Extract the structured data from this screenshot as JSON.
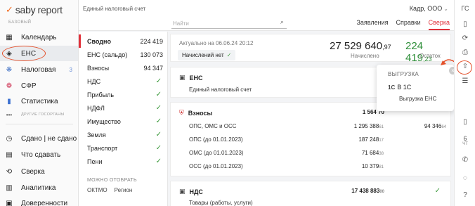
{
  "brand": {
    "check": "✓",
    "saby": "saby",
    "report": "report"
  },
  "sidebar": {
    "section_base": "БАЗОВЫЙ",
    "items": [
      {
        "label": "Календарь",
        "icon": "calendar-icon",
        "glyph": "▦",
        "count": ""
      },
      {
        "label": "ЕНС",
        "icon": "wallet-icon",
        "glyph": "◈",
        "count": ""
      },
      {
        "label": "Налоговая",
        "icon": "gear-icon",
        "glyph": "❋",
        "count": "3"
      },
      {
        "label": "СФР",
        "icon": "sfr-icon",
        "glyph": "❁",
        "count": ""
      },
      {
        "label": "Статистика",
        "icon": "chart-icon",
        "glyph": "▮",
        "count": ""
      }
    ],
    "more_glyph": "•••",
    "section_other": "ДРУГИЕ ГОСОРГАНЫ",
    "items2": [
      {
        "label": "Сдано | не сдано",
        "icon": "clock-icon",
        "glyph": "◷"
      },
      {
        "label": "Что сдавать",
        "icon": "docs-icon",
        "glyph": "▤"
      },
      {
        "label": "Сверка",
        "icon": "reconcile-icon",
        "glyph": "⟲"
      },
      {
        "label": "Аналитика",
        "icon": "analytics-icon",
        "glyph": "▥"
      },
      {
        "label": "Доверенности",
        "icon": "proxy-icon",
        "glyph": "▣"
      }
    ]
  },
  "topbar": {
    "breadcrumb": "Единый налоговый счет",
    "org": "Кадр, ООО",
    "org_chevron": "⌄",
    "search_placeholder": "Найти",
    "search_glyph": "⌕",
    "tabs": [
      {
        "label": "Заявления"
      },
      {
        "label": "Справки"
      },
      {
        "label": "Сверка"
      }
    ]
  },
  "list": {
    "items": [
      {
        "label": "Сводно",
        "value": "224 419",
        "ok": false
      },
      {
        "label": "ЕНС (сальдо)",
        "value": "130 073",
        "ok": false
      },
      {
        "label": "Взносы",
        "value": "94 347",
        "ok": false
      },
      {
        "label": "НДС",
        "value": "",
        "ok": true
      },
      {
        "label": "Прибыль",
        "value": "",
        "ok": true
      },
      {
        "label": "НДФЛ",
        "value": "",
        "ok": true
      },
      {
        "label": "Имущество",
        "value": "",
        "ok": true
      },
      {
        "label": "Земля",
        "value": "",
        "ok": true
      },
      {
        "label": "Транспорт",
        "value": "",
        "ok": true
      },
      {
        "label": "Пени",
        "value": "",
        "ok": true
      }
    ],
    "check": "✓",
    "filter_label": "МОЖНО ОТОБРАТЬ",
    "filter_opts": [
      "ОКТМО",
      "Регион"
    ]
  },
  "summary": {
    "date": "Актуально на 06.06.24  20:12",
    "badge": "Начислений нет",
    "accrued_main": "27 529 640",
    "accrued_cents": ",97",
    "accrued_caption": "Начислено",
    "balance_main": "224 419",
    "balance_cents": ",23",
    "balance_caption": "Остаток"
  },
  "ens_card": {
    "title": "ЕНС",
    "subtitle": "Единый налоговый счет",
    "icon_glyph": "▣"
  },
  "contrib_card": {
    "title": "Взносы",
    "icon_glyph": "⛨",
    "total": "1 564 70",
    "total_cents": "",
    "rows": [
      {
        "label": "ОПС, ОМС и ОСС",
        "value": "1 295 388",
        "cents": "61",
        "right": "94 346",
        "right_cents": "64"
      },
      {
        "label": "ОПС (до 01.01.2023)",
        "value": "187 248",
        "cents": "17",
        "right": "",
        "right_cents": ""
      },
      {
        "label": "ОМС (до 01.01.2023)",
        "value": "71 684",
        "cents": "38",
        "right": "",
        "right_cents": ""
      },
      {
        "label": "ОСС (до 01.01.2023)",
        "value": "10 379",
        "cents": "81",
        "right": "",
        "right_cents": ""
      }
    ]
  },
  "vat_card": {
    "title": "НДС",
    "icon_glyph": "▣",
    "total": "17 438 883",
    "total_cents": "00",
    "subtitle": "Товары (работы, услуги)",
    "check": "✓"
  },
  "popup": {
    "title": "ВЫГРУЗКА",
    "option1_glyph": "1С",
    "option1": "В 1С",
    "option2": "Выгрузка ЕНС",
    "close": "×"
  },
  "rail": {
    "gc": "ГС",
    "icons": [
      {
        "name": "file-icon",
        "glyph": "▯"
      },
      {
        "name": "refresh-icon",
        "glyph": "⟳"
      },
      {
        "name": "print-icon",
        "glyph": "⎙"
      },
      {
        "name": "upload-icon",
        "glyph": "⇧"
      },
      {
        "name": "list-icon",
        "glyph": "☰"
      }
    ],
    "lower": [
      {
        "name": "doc-icon",
        "glyph": "▯"
      },
      {
        "name": "calendar-day-icon",
        "glyph": "6",
        "sub": "ЧТ"
      },
      {
        "name": "phone-icon",
        "glyph": "✆"
      },
      {
        "name": "chat-icon",
        "glyph": "◌"
      },
      {
        "name": "help-icon",
        "glyph": "?"
      }
    ]
  },
  "colors": {
    "accent": "#e0303a",
    "green": "#2f8f3a",
    "orange": "#f26b21"
  }
}
